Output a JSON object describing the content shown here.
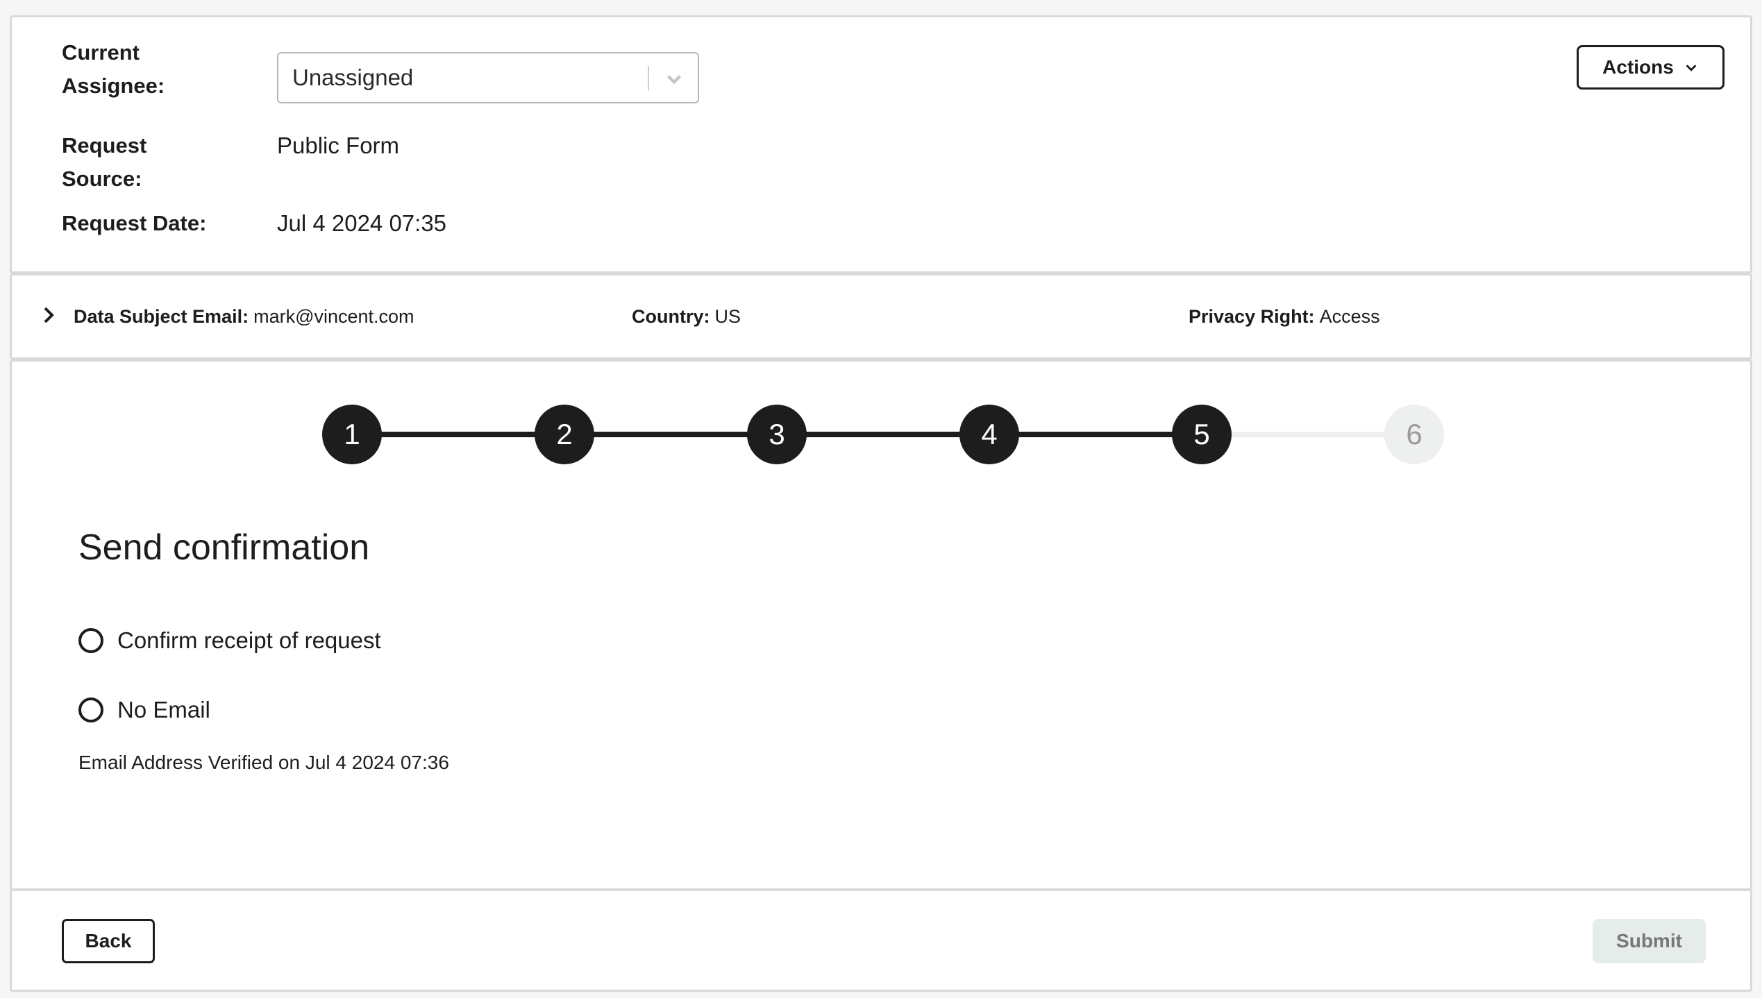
{
  "header": {
    "assignee_label": [
      "Current",
      "Assignee:"
    ],
    "assignee_value": "Unassigned",
    "source_label": [
      "Request",
      "Source:"
    ],
    "source_value": "Public Form",
    "date_label": "Request Date:",
    "date_value": "Jul 4 2024 07:35",
    "actions_label": "Actions"
  },
  "subject": {
    "email_label": "Data Subject Email:",
    "email_value": "mark@vincent.com",
    "country_label": "Country:",
    "country_value": "US",
    "right_label": "Privacy Right:",
    "right_value": "Access"
  },
  "stepper": {
    "steps": [
      "1",
      "2",
      "3",
      "4",
      "5",
      "6"
    ],
    "current_step": 5,
    "colors": {
      "done": "#1c1d1c",
      "todo": "#eef0ef"
    }
  },
  "step": {
    "title": "Send confirmation",
    "options": [
      "Confirm receipt of request",
      "No Email"
    ],
    "verified_text": "Email Address Verified on Jul 4 2024 07:36"
  },
  "footer": {
    "back_label": "Back",
    "submit_label": "Submit"
  }
}
